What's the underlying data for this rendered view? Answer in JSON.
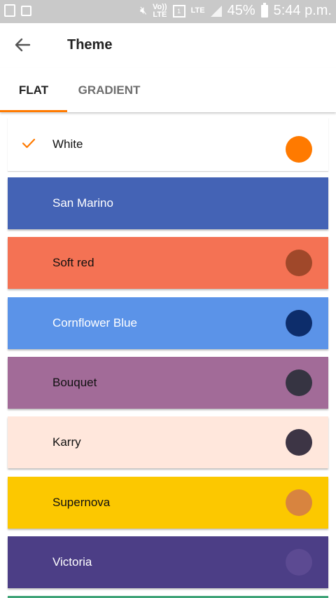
{
  "status_bar": {
    "battery": "45%",
    "time": "5:44 p.m.",
    "volte": "Vo))\nLTE",
    "sim": "1",
    "lte": "LTE"
  },
  "toolbar": {
    "title": "Theme"
  },
  "tabs": [
    {
      "label": "FLAT",
      "selected": true
    },
    {
      "label": "GRADIENT",
      "selected": false
    }
  ],
  "colors": {
    "accent": "#ff7a00"
  },
  "themes": [
    {
      "name": "White",
      "background": "#ffffff",
      "dot": "#ff7a00",
      "selected": true
    },
    {
      "name": "San Marino",
      "background": "#4463b5",
      "dot": null,
      "selected": false
    },
    {
      "name": "Soft red",
      "background": "#f47254",
      "dot": "#a0482a",
      "selected": false
    },
    {
      "name": "Cornflower Blue",
      "background": "#5b93e8",
      "dot": "#0d2d6b",
      "selected": false
    },
    {
      "name": "Bouquet",
      "background": "#a26b98",
      "dot": "#363442",
      "selected": false
    },
    {
      "name": "Karry",
      "background": "#ffe7dc",
      "dot": "#3d3545",
      "selected": false
    },
    {
      "name": "Supernova",
      "background": "#fcc800",
      "dot": "#d8843f",
      "selected": false
    },
    {
      "name": "Victoria",
      "background": "#4c3e86",
      "dot": "#5c4a92",
      "selected": false
    }
  ]
}
